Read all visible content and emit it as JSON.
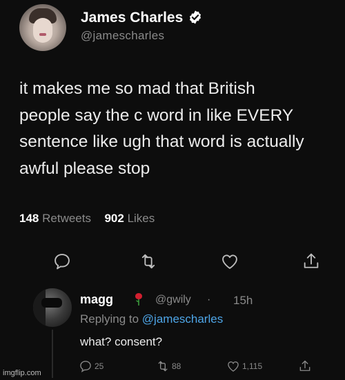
{
  "tweet": {
    "author": {
      "display_name": "James Charles",
      "handle": "@jamescharles",
      "verified": true
    },
    "text_lines": [
      "it makes me so mad that British",
      "people say the c word in like EVERY",
      "sentence like ugh that word is actually",
      "awful please stop"
    ],
    "stats": {
      "retweets": "148",
      "retweets_label": "Retweets",
      "likes": "902",
      "likes_label": "Likes"
    },
    "actions": [
      "reply-icon",
      "retweet-icon",
      "like-icon",
      "share-icon"
    ]
  },
  "reply": {
    "display_name": "magg",
    "handle": "@gwily",
    "dot": "·",
    "time": "15h",
    "replying_prefix": "Replying to",
    "replying_to": "@jamescharles",
    "text": "what? consent?",
    "counts": {
      "replies": "25",
      "retweets": "88",
      "likes": "1,115"
    }
  },
  "watermark": "imgflip.com",
  "colors": {
    "background": "#0d0d0d",
    "accent": "#4ea6e8",
    "muted": "#8a8a8a",
    "rose": "#d11f2f"
  }
}
